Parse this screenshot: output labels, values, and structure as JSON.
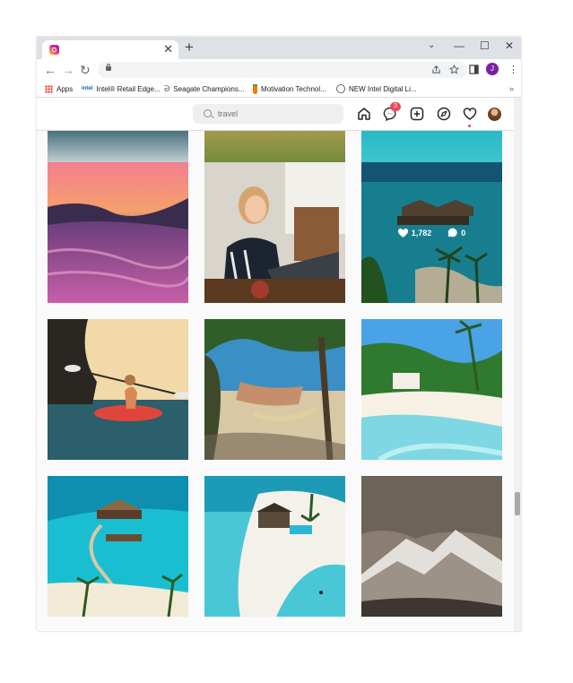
{
  "browser": {
    "tab": {
      "title": "",
      "close": "✕"
    },
    "new_tab": "+",
    "window_controls": {
      "tabsearch": "⌄",
      "minimize": "—",
      "maximize": "☐",
      "close": "✕"
    },
    "nav": {
      "back": "←",
      "forward": "→",
      "reload": "↻"
    },
    "address": "",
    "profile_initial": "J",
    "bookmarks": [
      {
        "label": "Apps",
        "icon": "apps-grid-icon"
      },
      {
        "label": "Intel® Retail Edge...",
        "icon": "intel-icon"
      },
      {
        "label": "Seagate Champions...",
        "icon": "seagate-icon"
      },
      {
        "label": "Motivation Technol...",
        "icon": "carrot-icon"
      },
      {
        "label": "NEW Intel Digital Li...",
        "icon": "globe-icon"
      }
    ],
    "bookmarks_overflow": "»"
  },
  "instagram": {
    "search": {
      "value": "",
      "placeholder": "travel"
    },
    "nav": {
      "home": "home-icon",
      "messenger": "messenger-icon",
      "messenger_badge": "3",
      "new_post": "plus-square-icon",
      "explore": "compass-icon",
      "activity": "heart-icon",
      "profile": "avatar"
    },
    "hover_post": {
      "likes": "1,782",
      "comments": "0"
    },
    "posts": [
      {
        "subject": "Pink sunset over sand dunes with reflective water"
      },
      {
        "subject": "Blonde woman with glasses working on a laptop in a cafe"
      },
      {
        "subject": "Overwater bungalows in a turquoise lagoon with palm trees"
      },
      {
        "subject": "Woman paddling a red kayak near sea cliffs"
      },
      {
        "subject": "Hammock strung between trees on a tropical beach"
      },
      {
        "subject": "Palm trees and white sand beach with turquoise water"
      },
      {
        "subject": "Aerial view of an overwater villa with a boardwalk"
      },
      {
        "subject": "Beachfront villa on a white sand island"
      },
      {
        "subject": "Snow-capped mountain peak under cloudy sky"
      }
    ]
  }
}
